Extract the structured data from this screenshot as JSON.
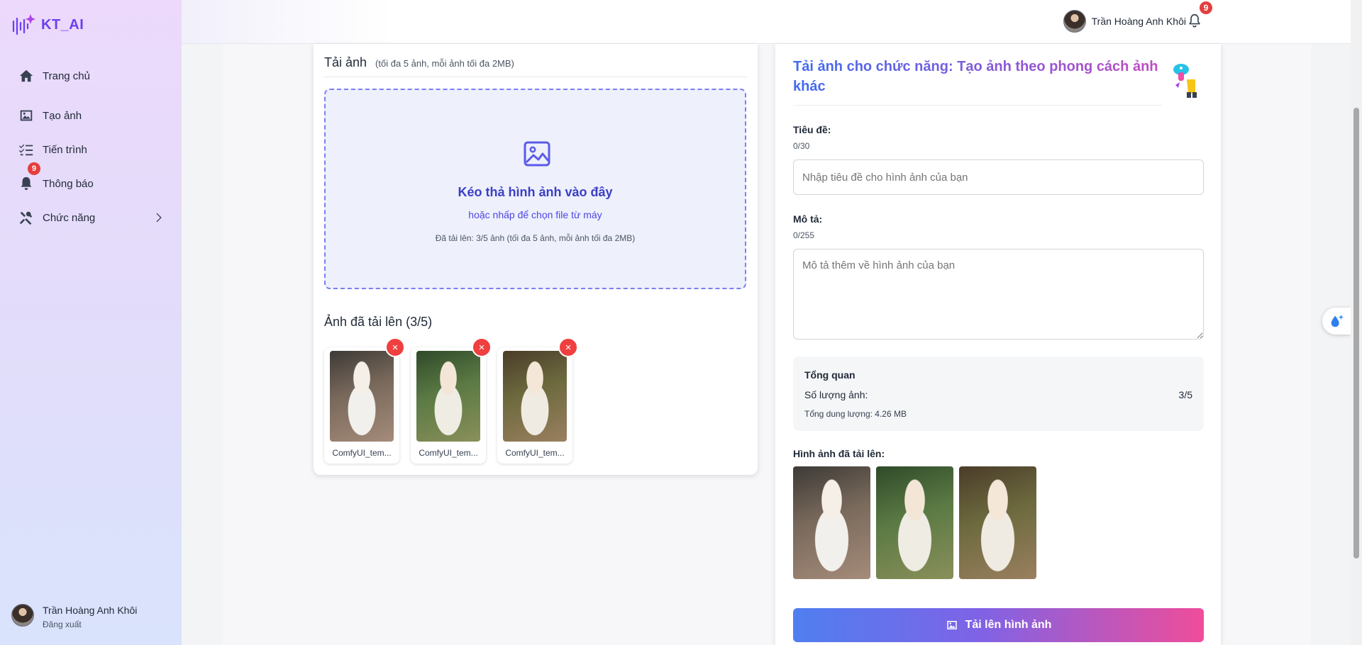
{
  "app": {
    "logo_text": "KT_AI"
  },
  "sidebar": {
    "items": [
      {
        "label": "Trang chủ",
        "icon": "home-icon"
      },
      {
        "label": "Tạo ảnh",
        "icon": "image-icon"
      },
      {
        "label": "Tiến trình",
        "icon": "tasks-icon"
      },
      {
        "label": "Thông báo",
        "icon": "bell-icon",
        "badge": "9"
      },
      {
        "label": "Chức năng",
        "icon": "tools-icon"
      }
    ],
    "user": {
      "name": "Trần Hoàng Anh Khôi",
      "logout": "Đăng xuất"
    }
  },
  "header": {
    "user_name": "Trần Hoàng Anh Khôi",
    "notification_count": "9"
  },
  "upload": {
    "title": "Tải ảnh",
    "subtitle": "(tối đa 5 ảnh, mỗi ảnh tối đa 2MB)",
    "dropzone": {
      "main": "Kéo thả hình ảnh vào đây",
      "sub": "hoặc nhấp để chọn file từ máy",
      "info": "Đã tải lên: 3/5 ảnh (tối đa 5 ảnh, mỗi ảnh tối đa 2MB)"
    },
    "uploaded_title": "Ảnh đã tải lên (3/5)",
    "files": [
      {
        "caption": "ComfyUI_tem..."
      },
      {
        "caption": "ComfyUI_tem..."
      },
      {
        "caption": "ComfyUI_tem..."
      }
    ],
    "remove_label": "×"
  },
  "form": {
    "title": "Tải ảnh cho chức năng: Tạo ảnh theo phong cách ảnh khác",
    "title_label": "Tiêu đề:",
    "title_count": "0/30",
    "title_placeholder": "Nhập tiêu đề cho hình ảnh của bạn",
    "desc_label": "Mô tả:",
    "desc_count": "0/255",
    "desc_placeholder": "Mô tả thêm về hình ảnh của bạn",
    "overview": {
      "title": "Tổng quan",
      "count_label": "Số lượng ảnh:",
      "count_value": "3/5",
      "size": "Tổng dung lượng: 4.26 MB"
    },
    "preview_title": "Hình ảnh đã tải lên:",
    "submit_label": "Tải lên hình ảnh"
  },
  "colors": {
    "accent": "#6d3ef0",
    "badge": "#e53e3e",
    "dropzone_border": "#7c7ff0",
    "submit_start": "#4f7ff0",
    "submit_end": "#ef4d9a"
  }
}
